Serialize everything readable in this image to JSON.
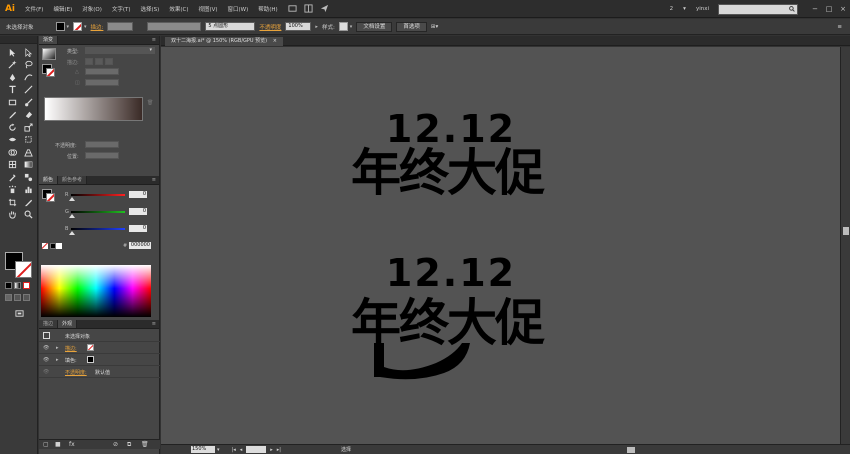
{
  "app": {
    "logo": "Ai"
  },
  "menu": {
    "items": [
      "文件(F)",
      "编辑(E)",
      "对象(O)",
      "文字(T)",
      "选择(S)",
      "效果(C)",
      "视图(V)",
      "窗口(W)",
      "帮助(H)"
    ]
  },
  "topright": {
    "workspace_num": "2",
    "user": "yinxi"
  },
  "control": {
    "selection_status": "未选择对象",
    "stroke_label": "描边:",
    "brush_label": "5 点圆形",
    "opacity_label": "不透明度",
    "opacity_value": "100%",
    "style_label": "样式:",
    "doc_setup_btn": "文档设置",
    "prefs_btn": "首选项"
  },
  "panels": {
    "gradient": {
      "tab": "渐变",
      "type_label": "类型:",
      "stroke_label": "描边:",
      "opacity_label": "不透明度:",
      "location_label": "位置:"
    },
    "color": {
      "tab_active": "颜色",
      "tab_other": "颜色参考",
      "channels": [
        {
          "label": "R",
          "value": "0",
          "color": "#ff2020"
        },
        {
          "label": "G",
          "value": "0",
          "color": "#20c020"
        },
        {
          "label": "B",
          "value": "0",
          "color": "#2040ff"
        }
      ],
      "hex_prefix": "#",
      "hex_value": "000000"
    },
    "appearance": {
      "tab_other": "描边",
      "tab_active": "外观",
      "title": "未选择对象",
      "stroke_label": "描边:",
      "fill_label": "填色:",
      "opacity_label": "不透明度:",
      "opacity_value": "默认值"
    }
  },
  "document": {
    "tab_label": "双十二海报.ai* @ 150% (RGB/GPU 预览)",
    "zoom": "150%",
    "status": "选择"
  },
  "artwork": {
    "number": "12.12",
    "slogan": "年终大促"
  },
  "colors": {
    "accent": "#ff9a00",
    "canvas": "#535353",
    "panel": "#464646"
  }
}
